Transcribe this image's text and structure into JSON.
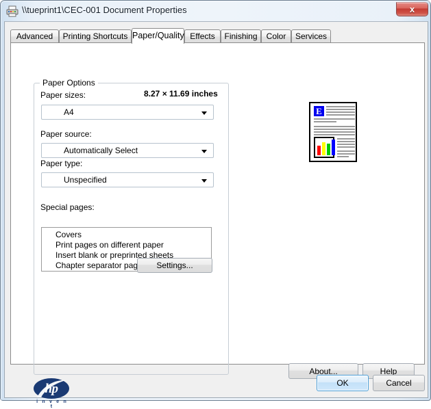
{
  "window": {
    "title": "\\\\tueprint1\\CEC-001 Document Properties",
    "icon": "printer-icon",
    "close_label": "x"
  },
  "tabs": [
    {
      "label": "Advanced",
      "active": false
    },
    {
      "label": "Printing Shortcuts",
      "active": false
    },
    {
      "label": "Paper/Quality",
      "active": true
    },
    {
      "label": "Effects",
      "active": false
    },
    {
      "label": "Finishing",
      "active": false
    },
    {
      "label": "Color",
      "active": false
    },
    {
      "label": "Services",
      "active": false
    }
  ],
  "paper_options": {
    "group_title": "Paper Options",
    "paper_sizes_label": "Paper sizes:",
    "dimensions": "8.27 × 11.69 inches",
    "paper_size_value": "A4",
    "paper_source_label": "Paper source:",
    "paper_source_value": "Automatically Select",
    "paper_type_label": "Paper type:",
    "paper_type_value": "Unspecified",
    "special_pages_label": "Special pages:",
    "special_pages": [
      "Covers",
      "Print pages on different paper",
      "Insert blank or preprinted sheets",
      "Chapter separator pages"
    ],
    "settings_button": "Settings..."
  },
  "preview": {
    "name": "document-preview",
    "dropcap": "E",
    "chart_bars": [
      {
        "color": "#ff0000",
        "height": 14
      },
      {
        "color": "#ffff00",
        "height": 19
      },
      {
        "color": "#00cc00",
        "height": 17
      },
      {
        "color": "#0000ff",
        "height": 23
      }
    ]
  },
  "branding": {
    "logo": "hp-logo",
    "wordmark": "hp",
    "tagline": "i n v e n t"
  },
  "buttons": {
    "about": "About...",
    "help": "Help",
    "ok": "OK",
    "cancel": "Cancel"
  },
  "colors": {
    "accent": "#1a3a73",
    "default_button_border": "#4a9ed8",
    "close_button": "#c23b33"
  }
}
